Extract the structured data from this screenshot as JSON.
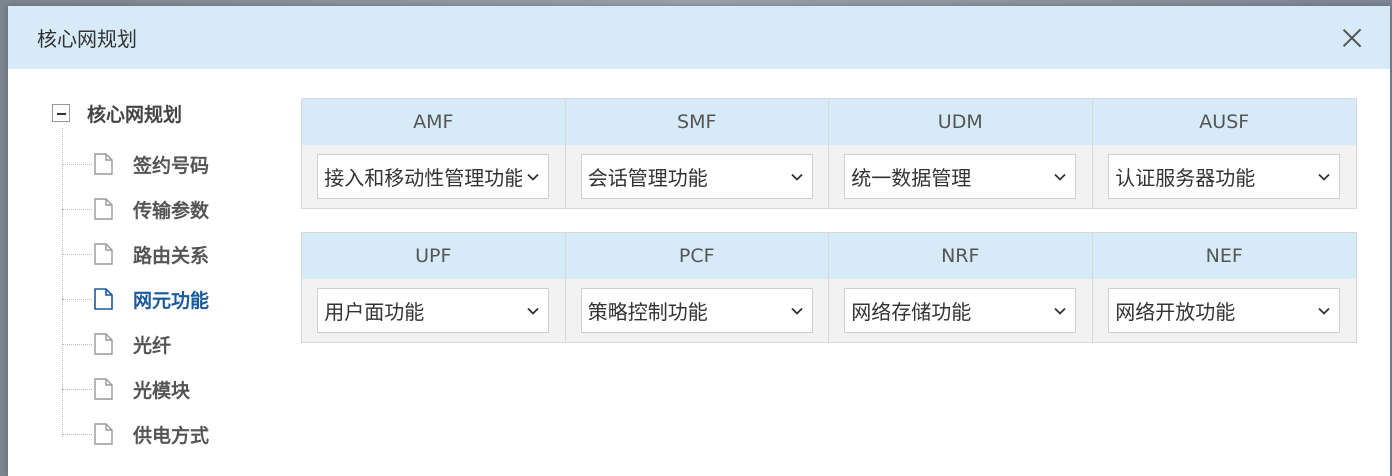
{
  "dialog": {
    "title": "核心网规划"
  },
  "tree": {
    "root_label": "核心网规划",
    "items": [
      {
        "label": "签约号码",
        "active": false
      },
      {
        "label": "传输参数",
        "active": false
      },
      {
        "label": "路由关系",
        "active": false
      },
      {
        "label": "网元功能",
        "active": true
      },
      {
        "label": "光纤",
        "active": false
      },
      {
        "label": "光模块",
        "active": false
      },
      {
        "label": "供电方式",
        "active": false
      }
    ]
  },
  "grid1": {
    "columns": [
      {
        "header": "AMF",
        "value": "接入和移动性管理功能"
      },
      {
        "header": "SMF",
        "value": "会话管理功能"
      },
      {
        "header": "UDM",
        "value": "统一数据管理"
      },
      {
        "header": "AUSF",
        "value": "认证服务器功能"
      }
    ]
  },
  "grid2": {
    "columns": [
      {
        "header": "UPF",
        "value": "用户面功能"
      },
      {
        "header": "PCF",
        "value": "策略控制功能"
      },
      {
        "header": "NRF",
        "value": "网络存储功能"
      },
      {
        "header": "NEF",
        "value": "网络开放功能"
      }
    ]
  },
  "colors": {
    "header_bg": "#d6eaf8",
    "active_item": "#1a5a9c"
  },
  "icons": {
    "close": "close-icon",
    "file": "file-icon",
    "collapse": "collapse-icon",
    "dropdown": "chevron-down-icon"
  }
}
